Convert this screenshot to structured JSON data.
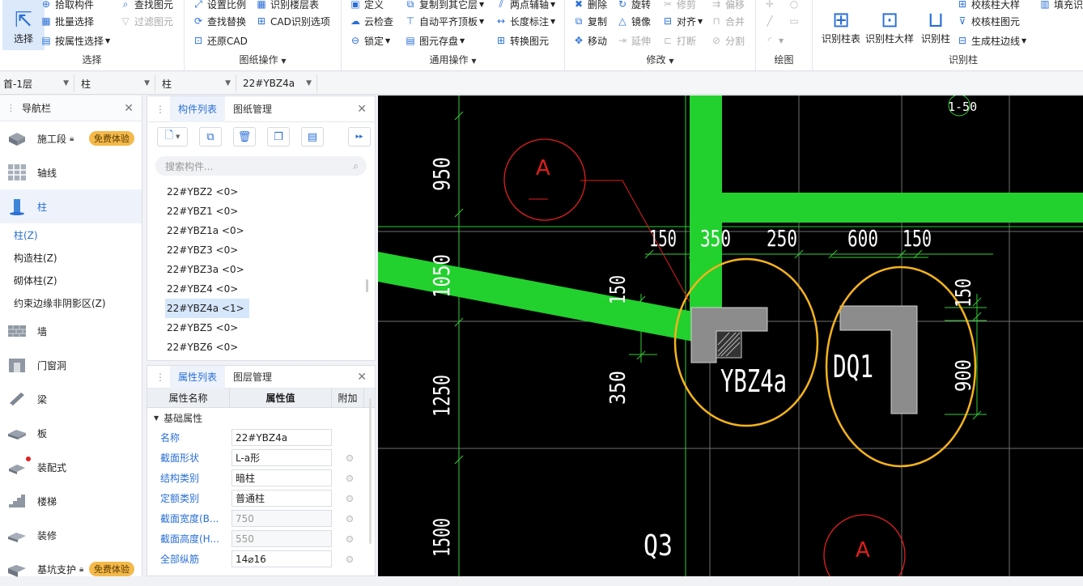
{
  "ribbon": {
    "select_group": {
      "big_button": "选择",
      "buttons": [
        "拾取构件",
        "批量选择",
        "按属性选择",
        "查找图元",
        "过滤图元"
      ],
      "label": "选择"
    },
    "drawing_group": {
      "buttons": [
        "设置比例",
        "识别楼层表",
        "查找替换",
        "CAD识别选项",
        "还原CAD"
      ],
      "label": "图纸操作"
    },
    "common_group": {
      "buttons": [
        "定义",
        "复制到其它层",
        "两点辅轴",
        "云检查",
        "自动平齐顶板",
        "长度标注",
        "锁定",
        "图元存盘",
        "转换图元"
      ],
      "label": "通用操作"
    },
    "modify_group": {
      "buttons": [
        "删除",
        "旋转",
        "修剪",
        "偏移",
        "复制",
        "镜像",
        "对齐",
        "合并",
        "移动",
        "延伸",
        "打断",
        "分割"
      ],
      "label": "修改"
    },
    "draw_group": {
      "label": "绘图"
    },
    "identify_group": {
      "big_buttons": [
        "识别柱表",
        "识别柱大样",
        "识别柱"
      ],
      "buttons": [
        "校核柱大样",
        "填充识别",
        "校核柱图元",
        "生成柱边线"
      ],
      "label": "识别柱"
    }
  },
  "combos": [
    "首-1层",
    "柱",
    "柱",
    "22#YBZ4a"
  ],
  "nav": {
    "title": "导航栏",
    "items": [
      {
        "label": "施工段",
        "badge": "免费体验",
        "lock": true
      },
      {
        "label": "轴线"
      },
      {
        "label": "柱",
        "active": true
      },
      {
        "label": "墙"
      },
      {
        "label": "门窗洞"
      },
      {
        "label": "梁"
      },
      {
        "label": "板"
      },
      {
        "label": "装配式",
        "dot": true
      },
      {
        "label": "楼梯"
      },
      {
        "label": "装修"
      },
      {
        "label": "基坑支护",
        "badge": "免费体验",
        "lock": true
      }
    ],
    "sub_items": [
      "柱(Z)",
      "构造柱(Z)",
      "砌体柱(Z)",
      "约束边缘非阴影区(Z)"
    ]
  },
  "component_panel": {
    "tabs": [
      "构件列表",
      "图纸管理"
    ],
    "search_placeholder": "搜索构件...",
    "items": [
      "22#YBZ2 <0>",
      "22#YBZ1 <0>",
      "22#YBZ1a <0>",
      "22#YBZ3 <0>",
      "22#YBZ3a <0>",
      "22#YBZ4 <0>",
      "22#YBZ4a <1>",
      "22#YBZ5 <0>",
      "22#YBZ6 <0>"
    ],
    "selected_index": 6
  },
  "property_panel": {
    "tabs": [
      "属性列表",
      "图层管理"
    ],
    "headers": [
      "属性名称",
      "属性值",
      "附加"
    ],
    "section": "基础属性",
    "rows": [
      {
        "name": "名称",
        "value": "22#YBZ4a",
        "grey": false
      },
      {
        "name": "截面形状",
        "value": "L-a形",
        "grey": false
      },
      {
        "name": "结构类别",
        "value": "暗柱",
        "grey": false
      },
      {
        "name": "定额类别",
        "value": "普通柱",
        "grey": false
      },
      {
        "name": "截面宽度(B...",
        "value": "750",
        "grey": true
      },
      {
        "name": "截面高度(H...",
        "value": "550",
        "grey": true
      },
      {
        "name": "全部纵筋",
        "value": "14⌀16",
        "grey": false
      }
    ]
  },
  "cad": {
    "scale_label": "1-50",
    "dims_top": [
      "150",
      "350",
      "250",
      "600",
      "150"
    ],
    "dims_left": [
      "950",
      "1050",
      "1250",
      "1500"
    ],
    "dim_small_v": "150",
    "dim_left_inner": "350",
    "dim_right_top": "150",
    "dim_right": "900",
    "label_ybz": "YBZ4a",
    "label_dq": "DQ1",
    "label_q3": "Q3",
    "axis_mark": "A",
    "colors": {
      "green": "#22d12e",
      "orange": "#f5b31c",
      "red": "#e01e1e",
      "grey": "#8c8c8c",
      "white": "#ffffff"
    }
  }
}
